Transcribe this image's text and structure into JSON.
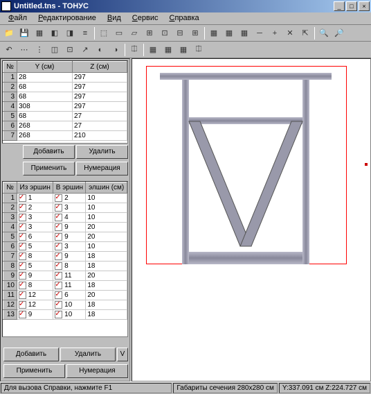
{
  "window": {
    "title": "Untitled.tns - ТОНУС"
  },
  "menu": {
    "file": "Файл",
    "edit": "Редактирование",
    "view": "Вид",
    "service": "Сервис",
    "help": "Справка"
  },
  "table1": {
    "headers": {
      "n": "№",
      "y": "Y (см)",
      "z": "Z (см)"
    },
    "rows": [
      {
        "n": "1",
        "y": "28",
        "z": "297"
      },
      {
        "n": "2",
        "y": "68",
        "z": "297"
      },
      {
        "n": "3",
        "y": "68",
        "z": "297"
      },
      {
        "n": "4",
        "y": "308",
        "z": "297"
      },
      {
        "n": "5",
        "y": "68",
        "z": "27"
      },
      {
        "n": "6",
        "y": "268",
        "z": "27"
      },
      {
        "n": "7",
        "y": "268",
        "z": "210"
      }
    ]
  },
  "buttons": {
    "add": "Добавить",
    "del": "Удалить",
    "apply": "Применить",
    "num": "Нумерация",
    "v": "V"
  },
  "table2": {
    "headers": {
      "n": "№",
      "from": "Из эршин",
      "to": "В эршин",
      "w": "элшин (см)"
    },
    "rows": [
      {
        "n": "1",
        "a": "1",
        "b": "2",
        "w": "10"
      },
      {
        "n": "2",
        "a": "2",
        "b": "3",
        "w": "10"
      },
      {
        "n": "3",
        "a": "3",
        "b": "4",
        "w": "10"
      },
      {
        "n": "4",
        "a": "3",
        "b": "9",
        "w": "20"
      },
      {
        "n": "5",
        "a": "6",
        "b": "9",
        "w": "20"
      },
      {
        "n": "6",
        "a": "5",
        "b": "3",
        "w": "10"
      },
      {
        "n": "7",
        "a": "8",
        "b": "9",
        "w": "18"
      },
      {
        "n": "8",
        "a": "5",
        "b": "8",
        "w": "18"
      },
      {
        "n": "9",
        "a": "9",
        "b": "11",
        "w": "20"
      },
      {
        "n": "10",
        "a": "8",
        "b": "11",
        "w": "18"
      },
      {
        "n": "11",
        "a": "12",
        "b": "6",
        "w": "20"
      },
      {
        "n": "12",
        "a": "12",
        "b": "10",
        "w": "18"
      },
      {
        "n": "13",
        "a": "9",
        "b": "10",
        "w": "18"
      }
    ]
  },
  "status": {
    "help": "Для вызова  Справки, нажмите F1",
    "dims": "Габариты сечения 280x280 см",
    "coords": "Y:337.091 см Z:224.727 см"
  },
  "icons": {
    "t1": [
      "📁",
      "💾",
      "▦",
      "◧",
      "◨",
      "≡"
    ],
    "t2": [
      "⬚",
      "▭",
      "▱",
      "⊞",
      "⊡",
      "⊟",
      "⊞",
      "│",
      "▦",
      "▦",
      "▦",
      "─",
      "+",
      "✕",
      "⇱",
      "│",
      "🔍",
      "🔎"
    ],
    "t3": [
      "↶",
      "⋯",
      "⋮",
      "◫",
      "⊡",
      "↗",
      "◐",
      "◑",
      "│",
      "⎅",
      "│",
      "▦",
      "▦",
      "▦",
      "⎅"
    ]
  }
}
